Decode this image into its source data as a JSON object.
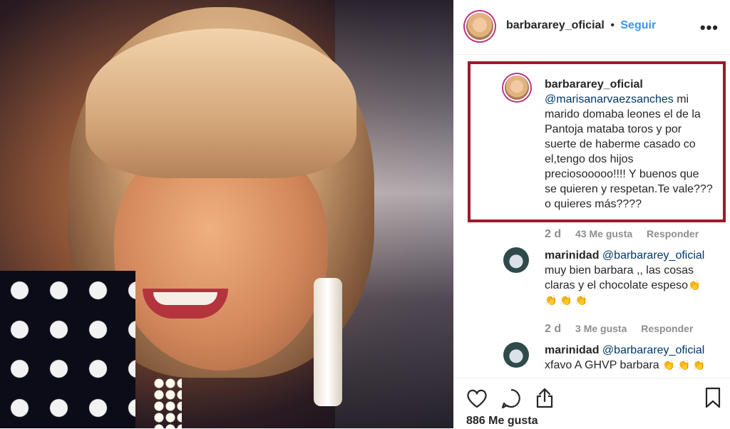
{
  "post": {
    "username": "barbararey_oficial",
    "separator": "•",
    "follow_label": "Seguir",
    "more_icon": "more-options-icon"
  },
  "comments": [
    {
      "username": "barbararey_oficial",
      "mention": "@marisanarvaezsanches",
      "lines": [
        "mi",
        "marido domaba leones el de la",
        "Pantoja mataba toros y por",
        "suerte de haberme casado co",
        "el,tengo dos hijos",
        "preciosooooo!!!! Y buenos que",
        "se quieren y respetan.Te vale???",
        "o quieres más????"
      ],
      "time": "2 d",
      "likes": "43 Me gusta",
      "reply_label": "Responder"
    },
    {
      "username": "marinidad",
      "mention": "@barbararey_oficial",
      "lines": [
        "muy bien barbara ,, las cosas",
        "claras y el chocolate espeso"
      ],
      "emoji_line": "👏 👏 👏",
      "inline_emoji": "👏",
      "time": "2 d",
      "likes": "3 Me gusta",
      "reply_label": "Responder"
    },
    {
      "username": "marinidad",
      "mention": "@barbararey_oficial",
      "lines": [
        "xfavo A GHVP barbara"
      ],
      "inline_emoji": "👏 👏 👏"
    }
  ],
  "actions": {
    "like_icon": "heart-icon",
    "comment_icon": "comment-icon",
    "share_icon": "share-icon",
    "save_icon": "bookmark-icon",
    "likes_count": "886 Me gusta"
  }
}
